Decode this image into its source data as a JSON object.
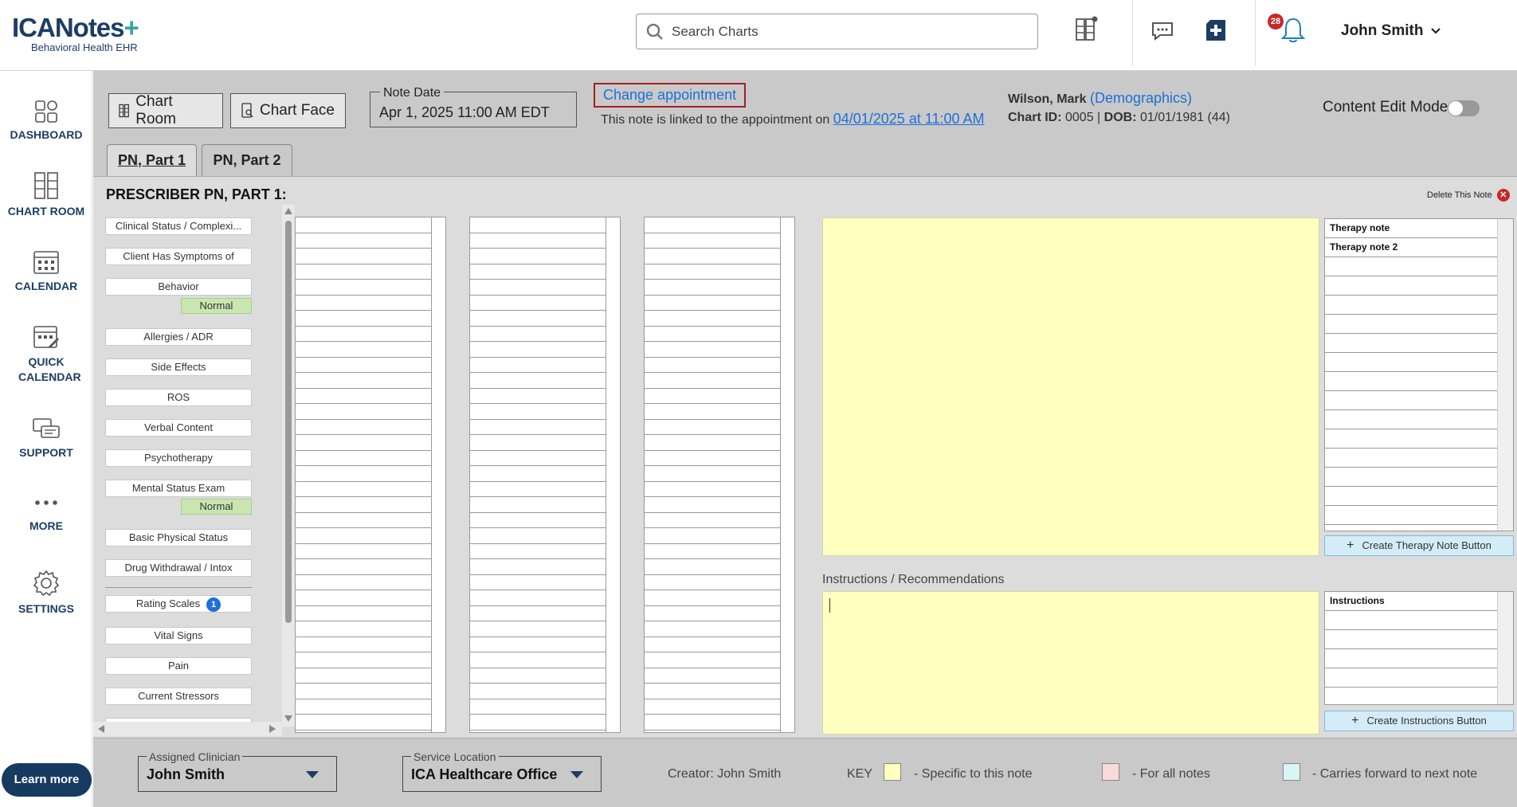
{
  "header": {
    "logo_main": "ICANotes",
    "logo_plus": "+",
    "logo_sub": "Behavioral Health EHR",
    "search_placeholder": "Search Charts",
    "notification_count": "28",
    "user_name": "John Smith"
  },
  "nav": {
    "items": [
      {
        "label": "DASHBOARD"
      },
      {
        "label": "CHART ROOM"
      },
      {
        "label": "CALENDAR"
      },
      {
        "label": "QUICK CALENDAR"
      },
      {
        "label": "SUPPORT"
      },
      {
        "label": "MORE"
      },
      {
        "label": "SETTINGS"
      }
    ],
    "learn_more": "Learn more"
  },
  "toolbar": {
    "chart_room": "Chart Room",
    "chart_face": "Chart Face",
    "note_date_label": "Note Date",
    "note_date_value": "Apr 1, 2025 11:00 AM EDT",
    "change_appointment": "Change appointment",
    "linked_text": "This note is linked to the appointment on ",
    "linked_link": "04/01/2025 at 11:00 AM",
    "patient_name": "Wilson, Mark ",
    "demographics": "(Demographics)",
    "chart_id_label": "Chart ID:",
    "chart_id": " 0005 | ",
    "dob_label": "DOB:",
    "dob": " 01/01/1981 (44)",
    "content_edit_mode": "Content Edit Mode"
  },
  "tabs": [
    {
      "label": "PN, Part 1"
    },
    {
      "label": "PN, Part 2"
    }
  ],
  "panel": {
    "title": "PRESCRIBER PN, PART 1:",
    "delete_note": "Delete This Note",
    "sections": {
      "s0": "Clinical Status / Complexi...",
      "s1": "Client Has Symptoms of",
      "s2": "Behavior",
      "s2n": "Normal",
      "s3": "Allergies / ADR",
      "s4": "Side Effects",
      "s5": "ROS",
      "s6": "Verbal Content",
      "s7": "Psychotherapy",
      "s8": "Mental Status Exam",
      "s8n": "Normal",
      "s9": "Basic Physical Status",
      "s10": "Drug Withdrawal / Intox",
      "s11": "Rating Scales",
      "s11c": "1",
      "s12": "Vital Signs",
      "s13": "Pain",
      "s14": "Current Stressors"
    },
    "therapy_notes": [
      "Therapy note",
      "Therapy note 2"
    ],
    "create_therapy": "Create Therapy Note Button",
    "instructions_label": "Instructions / Recommendations",
    "instructions_list": [
      "Instructions"
    ],
    "create_instructions": "Create Instructions Button"
  },
  "footer": {
    "assigned_label": "Assigned Clinician",
    "assigned_value": "John Smith",
    "location_label": "Service Location",
    "location_value": "ICA Healthcare Office",
    "creator": "Creator: John Smith",
    "key": "KEY",
    "key_specific": "- Specific to this note",
    "key_all": "- For all notes",
    "key_carry": "- Carries forward to next note",
    "colors": {
      "specific": "#ffffc0",
      "all": "#f9d9d9",
      "carry": "#d9f5f5"
    }
  }
}
